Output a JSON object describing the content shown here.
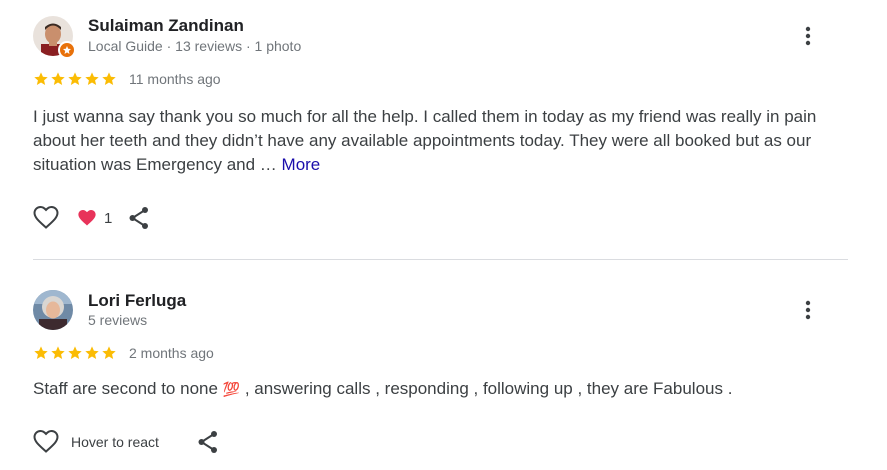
{
  "reviews": [
    {
      "author": "Sulaiman Zandinan",
      "meta": "Local Guide · 13 reviews · 1 photo",
      "rating": 5,
      "age": "11 months ago",
      "text": "I just wanna say thank you so much for all the help. I called them in today as my friend was really in pain about her teeth and they didn’t have any available appointments today. They were all booked but as our situation was Emergency and …",
      "more_label": "More",
      "reaction_count": "1",
      "icons": [
        "heart-outline-icon",
        "heart-reaction-icon",
        "share-icon",
        "more-vert-icon",
        "local-guide-badge-icon"
      ]
    },
    {
      "author": "Lori Ferluga",
      "meta": "5 reviews",
      "rating": 5,
      "age": "2 months ago",
      "text_before": "Staff are second to none ",
      "emoji": "💯",
      "text_after": " , answering calls , responding , following up , they are Fabulous .",
      "hover_label": "Hover to react",
      "icons": [
        "heart-outline-icon",
        "share-icon",
        "more-vert-icon"
      ]
    }
  ],
  "colors": {
    "star": "#fbbc04",
    "link": "#1a0dab",
    "heart_reaction": "#e8335a",
    "guide_badge": "#e8710a"
  }
}
